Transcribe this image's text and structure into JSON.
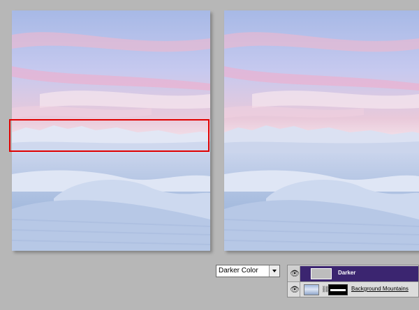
{
  "blend_mode": {
    "selected": "Darker Color"
  },
  "layers": [
    {
      "name": "Darker",
      "selected": true,
      "visible": true
    },
    {
      "name": "Background Mountains",
      "selected": false,
      "visible": true,
      "has_mask": true
    }
  ],
  "colors": {
    "background": "#b7b7b7",
    "highlight": "#e00000",
    "selected_layer": "#3b2570"
  },
  "icons": [
    "eye-icon",
    "link-icon",
    "dropdown-arrow-icon"
  ]
}
